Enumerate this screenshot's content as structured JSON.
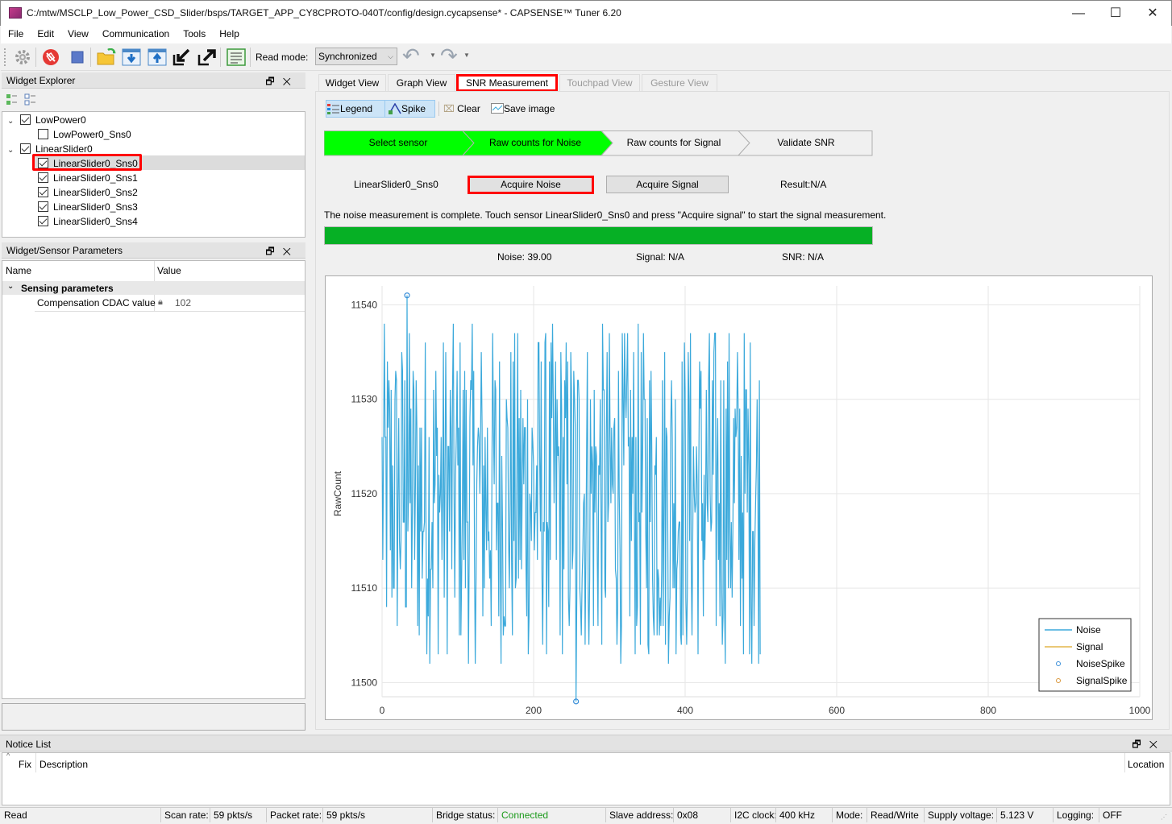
{
  "window": {
    "title": "C:/mtw/MSCLP_Low_Power_CSD_Slider/bsps/TARGET_APP_CY8CPROTO-040T/config/design.cycapsense* - CAPSENSE™ Tuner 6.20",
    "minimize": "—",
    "maximize": "☐",
    "close": "✕"
  },
  "menu": [
    "File",
    "Edit",
    "View",
    "Communication",
    "Tools",
    "Help"
  ],
  "toolbar": {
    "icons": [
      "gear-icon",
      "disconnect-icon",
      "stop-icon",
      "open-folder-icon",
      "read-from-device-icon",
      "write-to-device-icon",
      "import-icon",
      "export-icon",
      "log-icon"
    ],
    "read_mode_label": "Read mode:",
    "read_mode_value": "Synchronized",
    "undo": "↶",
    "redo": "↷"
  },
  "widget_explorer": {
    "title": "Widget Explorer",
    "tree": [
      {
        "label": "LowPower0",
        "level": 0,
        "checked": true,
        "expanded": true
      },
      {
        "label": "LowPower0_Sns0",
        "level": 1,
        "checked": false
      },
      {
        "label": "LinearSlider0",
        "level": 0,
        "checked": true,
        "expanded": true
      },
      {
        "label": "LinearSlider0_Sns0",
        "level": 1,
        "checked": true,
        "selected": true
      },
      {
        "label": "LinearSlider0_Sns1",
        "level": 1,
        "checked": true
      },
      {
        "label": "LinearSlider0_Sns2",
        "level": 1,
        "checked": true
      },
      {
        "label": "LinearSlider0_Sns3",
        "level": 1,
        "checked": true
      },
      {
        "label": "LinearSlider0_Sns4",
        "level": 1,
        "checked": true
      }
    ]
  },
  "parameters": {
    "title": "Widget/Sensor Parameters",
    "col_name": "Name",
    "col_value": "Value",
    "group": "Sensing parameters",
    "rows": [
      {
        "name": "Compensation CDAC value",
        "value": "102",
        "locked": true
      }
    ]
  },
  "tabs": [
    {
      "label": "Widget View",
      "enabled": true
    },
    {
      "label": "Graph View",
      "enabled": true
    },
    {
      "label": "SNR Measurement",
      "enabled": true,
      "active": true
    },
    {
      "label": "Touchpad View",
      "enabled": false
    },
    {
      "label": "Gesture View",
      "enabled": false
    }
  ],
  "snr": {
    "toolbar": {
      "legend": "Legend",
      "spike": "Spike",
      "clear": "Clear",
      "save_image": "Save image"
    },
    "steps": [
      {
        "label": "Select sensor",
        "done": true
      },
      {
        "label": "Raw counts for Noise",
        "done": true
      },
      {
        "label": "Raw counts for Signal",
        "done": false
      },
      {
        "label": "Validate SNR",
        "done": false
      }
    ],
    "sensor_name": "LinearSlider0_Sns0",
    "acquire_noise": "Acquire Noise",
    "acquire_signal": "Acquire Signal",
    "result": "Result:N/A",
    "message": "The noise measurement is complete. Touch sensor LinearSlider0_Sns0 and press \"Acquire signal\" to start the signal measurement.",
    "progress": 1.0,
    "noise": "Noise:  39.00",
    "signal": "Signal:  N/A",
    "snr": "SNR:  N/A",
    "colors": {
      "step_done": "#00ff00",
      "progress": "#06b025",
      "highlight": "#ff0000",
      "noise_line": "#3ba9db",
      "signal_line": "#e3b64a"
    }
  },
  "chart_data": {
    "type": "line",
    "title": "",
    "xlabel": "",
    "ylabel": "RawCount",
    "xlim": [
      0,
      1000
    ],
    "ylim": [
      11498.5,
      11542
    ],
    "xticks": [
      0,
      200,
      400,
      600,
      800,
      1000
    ],
    "yticks": [
      11500,
      11510,
      11520,
      11530,
      11540
    ],
    "grid": true,
    "legend_position": "bottom-right",
    "legend": [
      "Noise",
      "Signal",
      "NoiseSpike",
      "SignalSpike"
    ],
    "series": [
      {
        "name": "Noise",
        "x_range": [
          0,
          499
        ],
        "mean": 11519,
        "min": 11498,
        "max": 11541,
        "note": "500 noisy samples between ~11501 and ~11540"
      },
      {
        "name": "Signal",
        "values": []
      }
    ],
    "spikes": [
      {
        "name": "NoiseSpike",
        "x": 33,
        "y": 11541
      },
      {
        "name": "NoiseSpike",
        "x": 256,
        "y": 11498
      }
    ]
  },
  "notice_list": {
    "title": "Notice List",
    "col_fix": "Fix",
    "col_description": "Description",
    "col_location": "Location"
  },
  "status": {
    "read": "Read",
    "scan_rate_label": "Scan rate:",
    "scan_rate": "59 pkts/s",
    "packet_rate_label": "Packet rate:",
    "packet_rate": "59 pkts/s",
    "bridge_label": "Bridge status:",
    "bridge": "Connected",
    "slave_label": "Slave address:",
    "slave": "0x08",
    "i2c_label": "I2C clock:",
    "i2c": "400 kHz",
    "mode_label": "Mode:",
    "mode": "Read/Write",
    "supply_label": "Supply voltage:",
    "supply": "5.123 V",
    "logging_label": "Logging:",
    "logging": "OFF"
  }
}
